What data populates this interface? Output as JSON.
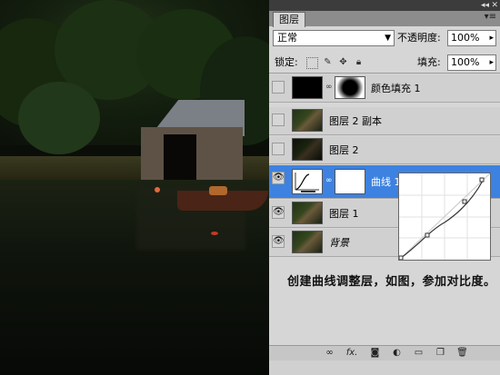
{
  "panel": {
    "tab_label": "图层",
    "menu_icon": "panel-menu-icon",
    "blend_mode": "正常",
    "opacity_label": "不透明度:",
    "opacity_value": "100%",
    "lock_label": "锁定:",
    "fill_label": "填充:",
    "fill_value": "100%"
  },
  "layers": [
    {
      "name": "颜色填充 1",
      "visible": false,
      "selected": false
    },
    {
      "name": "图层 2 副本",
      "visible": false,
      "selected": false
    },
    {
      "name": "图层 2",
      "visible": false,
      "selected": false
    },
    {
      "name": "曲线 1",
      "visible": true,
      "selected": true
    },
    {
      "name": "图层 1",
      "visible": true,
      "selected": false
    },
    {
      "name": "背景",
      "visible": true,
      "selected": false
    }
  ],
  "caption": "创建曲线调整层，如图，参加对比度。",
  "bottom_icons": [
    "link-layers-icon",
    "fx-icon",
    "add-mask-icon",
    "adjustment-layer-icon",
    "new-group-icon",
    "new-layer-icon",
    "trash-icon"
  ],
  "bottom_labels": {
    "fx": "fx."
  },
  "colors": {
    "selection": "#3d82e0",
    "panel_bg": "#d6d6d6"
  }
}
